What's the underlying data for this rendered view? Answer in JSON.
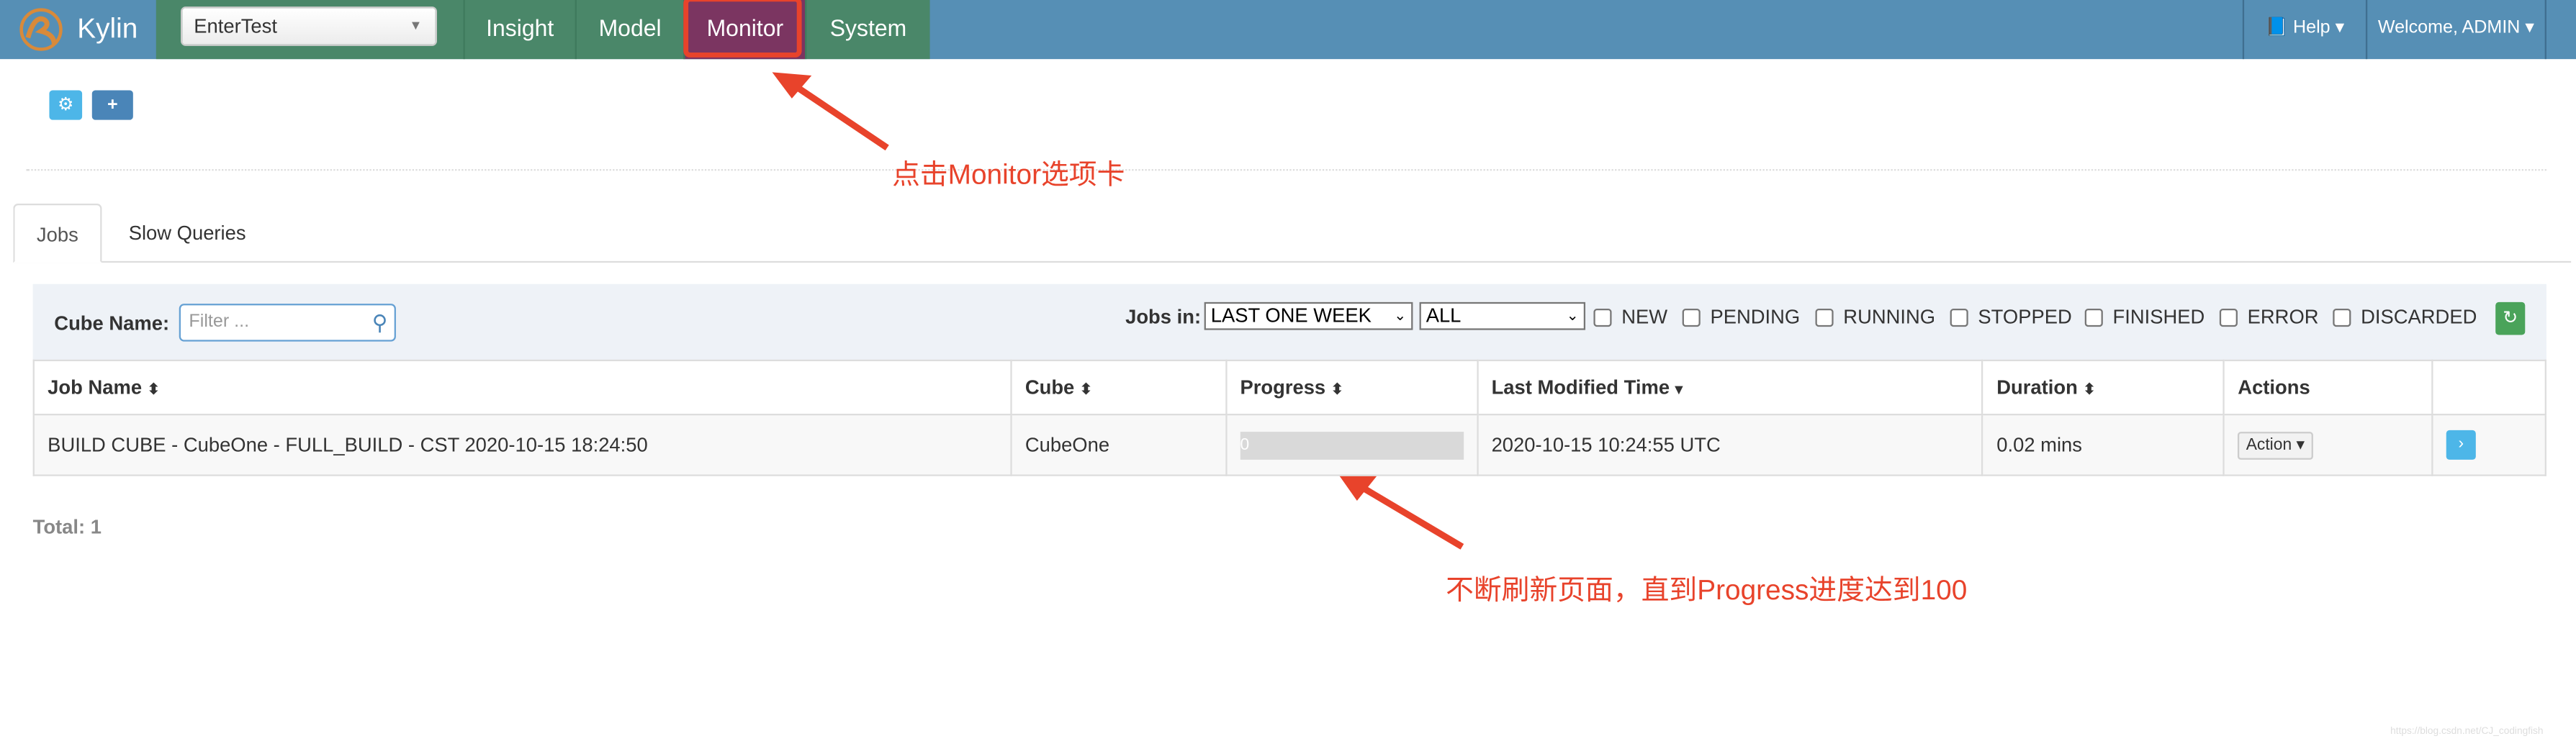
{
  "navbar": {
    "brand": "Kylin",
    "project": "EnterTest",
    "items": [
      {
        "label": "Insight"
      },
      {
        "label": "Model"
      },
      {
        "label": "Monitor",
        "active": true
      },
      {
        "label": "System"
      }
    ],
    "help": "Help",
    "user": "Welcome, ADMIN"
  },
  "annotations": {
    "click_monitor": "点击Monitor选项卡",
    "refresh_hint": "不断刷新页面，直到Progress进度达到100"
  },
  "tabs": [
    {
      "label": "Jobs",
      "active": true
    },
    {
      "label": "Slow Queries"
    }
  ],
  "filters": {
    "cube_name_label": "Cube Name:",
    "cube_name_placeholder": "Filter ...",
    "jobs_in_label": "Jobs in:",
    "time_range": "LAST ONE WEEK",
    "job_type": "ALL",
    "statuses": [
      "NEW",
      "PENDING",
      "RUNNING",
      "STOPPED",
      "FINISHED",
      "ERROR",
      "DISCARDED"
    ]
  },
  "table": {
    "headers": [
      "Job Name",
      "Cube",
      "Progress",
      "Last Modified Time",
      "Duration",
      "Actions"
    ],
    "rows": [
      {
        "job_name": "BUILD CUBE - CubeOne - FULL_BUILD - CST 2020-10-15 18:24:50",
        "cube": "CubeOne",
        "progress": "0",
        "last_modified": "2020-10-15 10:24:55 UTC",
        "duration": "0.02 mins",
        "action": "Action"
      }
    ]
  },
  "total": "Total: 1",
  "watermark": "https://blog.csdn.net/CJ_codingfish",
  "colors": {
    "navbar": "#568fb5",
    "nav_green": "#4a8769",
    "active_tab": "#7b3561",
    "annotation": "#e8432b"
  }
}
